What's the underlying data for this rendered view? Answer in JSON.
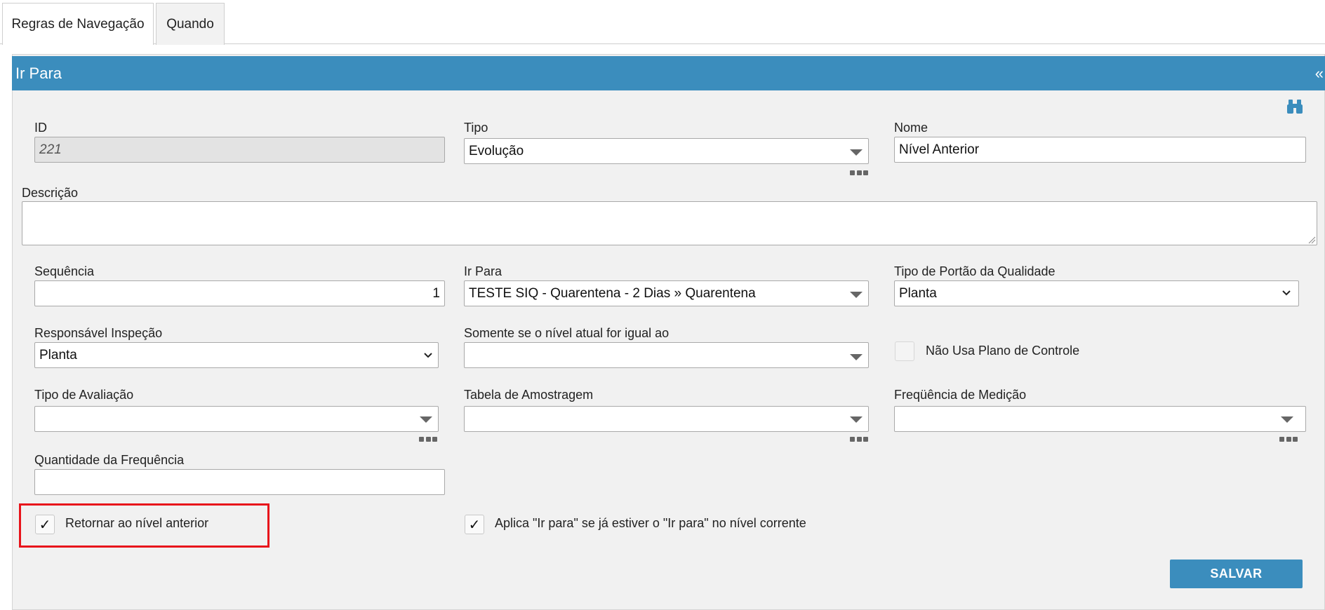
{
  "tabs": [
    {
      "label": "Regras de Navegação",
      "active": true
    },
    {
      "label": "Quando",
      "active": false
    }
  ],
  "panel": {
    "title": "Ir Para",
    "collapse_icon": "«",
    "search_icon": "binoculars-icon"
  },
  "form": {
    "id": {
      "label": "ID",
      "value": "221"
    },
    "tipo": {
      "label": "Tipo",
      "value": "Evolução"
    },
    "nome": {
      "label": "Nome",
      "value": "Nível Anterior"
    },
    "descricao": {
      "label": "Descrição",
      "value": ""
    },
    "sequencia": {
      "label": "Sequência",
      "value": "1"
    },
    "ir_para": {
      "label": "Ir Para",
      "value": "TESTE SIQ - Quarentena - 2 Dias » Quarentena"
    },
    "tipo_portao": {
      "label": "Tipo de Portão da Qualidade",
      "value": "Planta"
    },
    "responsavel": {
      "label": "Responsável Inspeção",
      "value": "Planta"
    },
    "somente_se": {
      "label": "Somente se o nível atual for igual ao",
      "value": ""
    },
    "nao_usa_plano": {
      "label": "Não Usa Plano de Controle",
      "checked": false
    },
    "tipo_avaliacao": {
      "label": "Tipo de Avaliação",
      "value": ""
    },
    "tabela_amostragem": {
      "label": "Tabela de Amostragem",
      "value": ""
    },
    "frequencia_medicao": {
      "label": "Freqüência de Medição",
      "value": ""
    },
    "quantidade_frequencia": {
      "label": "Quantidade da Frequência",
      "value": ""
    },
    "retornar": {
      "label": "Retornar ao nível anterior",
      "checked": true
    },
    "aplica": {
      "label": "Aplica \"Ir para\" se já estiver o \"Ir para\" no nível corrente",
      "checked": true
    }
  },
  "buttons": {
    "save": "SALVAR"
  },
  "colors": {
    "accent": "#3b8dbd",
    "highlight": "#e8141b"
  }
}
